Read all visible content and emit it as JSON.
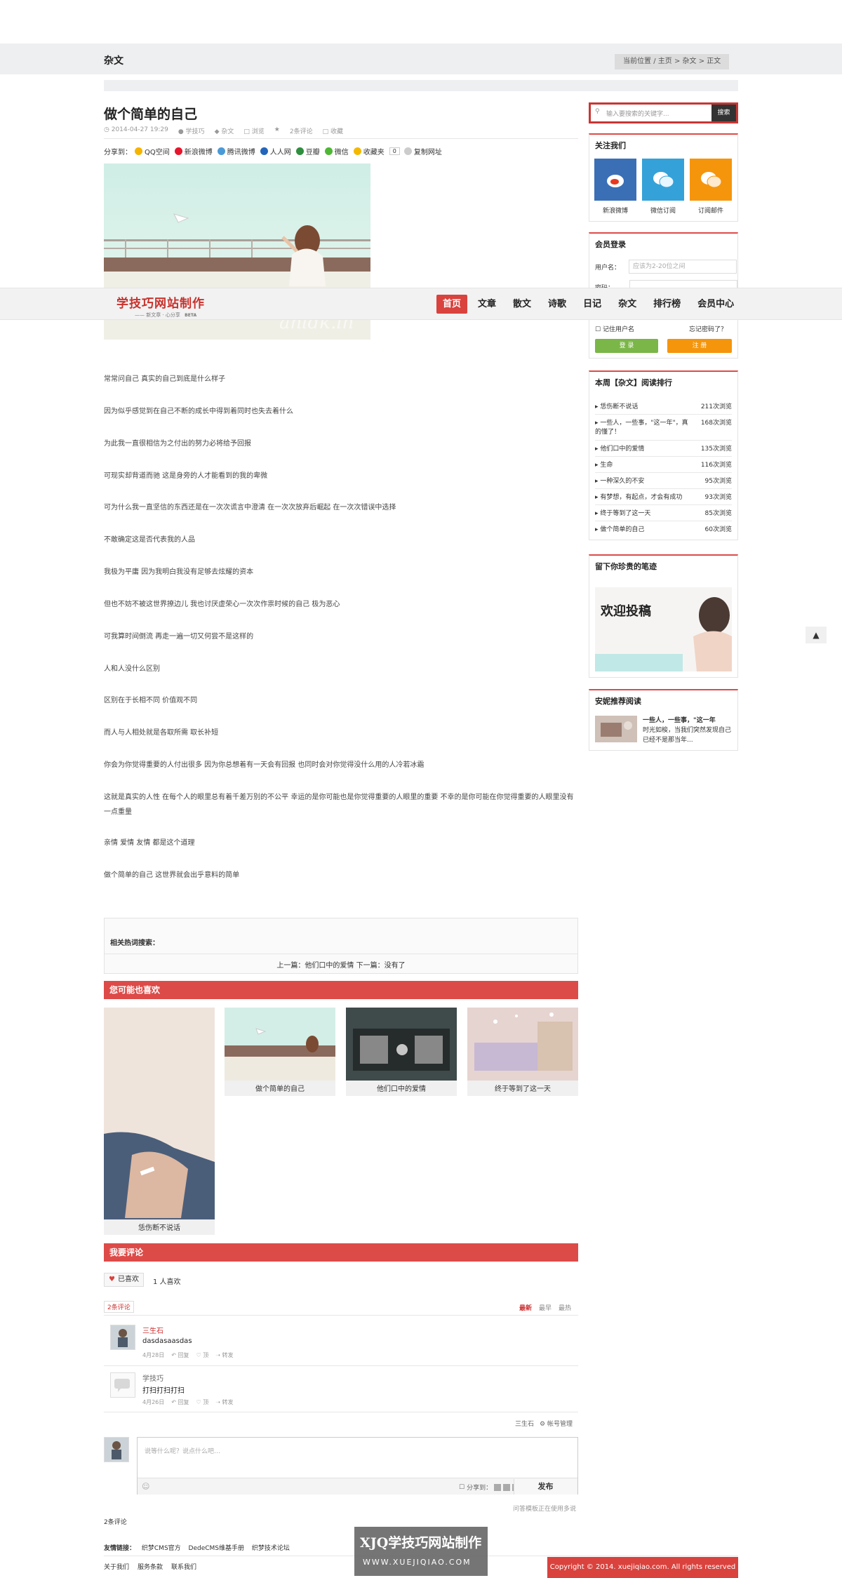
{
  "header": {
    "category": "杂文",
    "breadcrumb": {
      "prefix": "当前位置",
      "sep": "/",
      "home": "主页",
      "arrow": ">",
      "cat": "杂文",
      "current": "正文"
    }
  },
  "nav": {
    "logo_text": "学技巧网站制作",
    "logo_sub": "—— 新文章 · 心分享",
    "logo_badge": "BETA",
    "items": [
      "首页",
      "文章",
      "散文",
      "诗歌",
      "日记",
      "杂文",
      "排行榜",
      "会员中心"
    ],
    "active_index": 0
  },
  "article": {
    "title": "做个简单的自己",
    "meta": {
      "date": "2014-04-27 19:29",
      "author": "学技巧",
      "cat": "杂文",
      "views": "浏览",
      "comments": "2条评论",
      "fav": "收藏"
    },
    "share": {
      "label": "分享到：",
      "items": [
        {
          "label": "QQ空间",
          "color": "#f4b400"
        },
        {
          "label": "新浪微博",
          "color": "#e6162d"
        },
        {
          "label": "腾讯微博",
          "color": "#4a9ad8"
        },
        {
          "label": "人人网",
          "color": "#2266bb"
        },
        {
          "label": "豆瓣",
          "color": "#2f8f3f"
        },
        {
          "label": "微信",
          "color": "#4fb735"
        },
        {
          "label": "收藏夹",
          "color": "#f5b800"
        }
      ],
      "count": "0",
      "copy": "复制网址"
    },
    "image_watermark": "anldk.in",
    "paragraphs": [
      "常常问自己 真实的自己到底是什么样子",
      "因为似乎感觉到在自己不断的成长中得到着同时也失去着什么",
      "为此我一直很相信为之付出的努力必将给予回报",
      "可现实却背道而驰 这是身旁的人才能看到的我的卑微",
      "可为什么我一直坚信的东西还是在一次次谎言中澄清 在一次次放弃后崛起 在一次次错误中选择",
      "不敢确定这是否代表我的人品",
      "我极为平庸 因为我明白我没有足够去炫耀的资本",
      "但也不妨不被这世界撩边儿 我也讨厌虚荣心一次次作祟时候的自己 极为恶心",
      "可我算时间倒流 再走一遍一切又何尝不是这样的",
      "人和人没什么区别",
      "区别在于长相不同 价值观不同",
      "而人与人相处就是各取所需 取长补短",
      "你会为你觉得重要的人付出很多 因为你总想着有一天会有回报 也同时会对你觉得没什么用的人冷若冰霜",
      "这就是真实的人性 在每个人的眼里总有着千差万别的不公平 幸运的是你可能也是你觉得重要的人眼里的重要 不幸的是你可能在你觉得重要的人眼里没有一点重量",
      "亲情 爱情 友情 都是这个道理",
      "做个简单的自己 这世界就会出乎意料的简单"
    ],
    "hot_search": "相关热词搜索：",
    "prevnext": "上一篇：他们口中的爱情 下一篇：没有了"
  },
  "recommend": {
    "title": "您可能也喜欢",
    "items": [
      "恁伤断不说话",
      "做个简单的自己",
      "他们口中的爱情",
      "终于等到了这一天"
    ]
  },
  "comments": {
    "section_title": "我要评论",
    "like_label": "已喜欢",
    "like_count": "1 人喜欢",
    "count_badge": "2条评论",
    "sort": [
      "最新",
      "最早",
      "最热"
    ],
    "list": [
      {
        "name": "三生石",
        "text": "dasdasaasdas",
        "date": "4月28日",
        "reply": "回复",
        "up": "顶",
        "fwd": "转发"
      },
      {
        "name": "学技巧",
        "text": "打扫打扫打扫",
        "date": "4月26日",
        "reply": "回复",
        "up": "顶",
        "fwd": "转发"
      }
    ],
    "footer_user": "三生石",
    "footer_manage": "帐号管理",
    "placeholder": "说等什么呢？说点什么吧…",
    "share_to": "分享到：",
    "publish": "发布",
    "note": "问答模板正在使用多说",
    "total": "2条评论"
  },
  "footer": {
    "links_label": "友情链接：",
    "links": [
      "织梦CMS官方",
      "DedeCMS维基手册",
      "织梦技术论坛"
    ],
    "bottom": [
      "关于我们",
      "服务条款",
      "联系我们"
    ],
    "logo_main": "XJQ学技巧网站制作",
    "logo_url": "WWW.XUEJIQIAO.COM",
    "copyright": "Copyright © 2014. xuejiqiao.com. All rights reserved"
  },
  "sidebar": {
    "search_placeholder": "输入要搜索的关键字...",
    "search_button": "搜索",
    "follow": {
      "title": "关注我们",
      "items": [
        {
          "label": "新浪微博",
          "color": "#3a6fb6"
        },
        {
          "label": "微信订阅",
          "color": "#34a2d8"
        },
        {
          "label": "订阅邮件",
          "color": "#f5950c"
        }
      ]
    },
    "login": {
      "title": "会员登录",
      "user_label": "用户名：",
      "user_placeholder": "应该为2-20位之间",
      "pass_label": "密码：",
      "remember": "记住用户名",
      "forgot": "忘记密码了？",
      "login_btn": "登 录",
      "register_btn": "注 册"
    },
    "ranking": {
      "title": "本周【杂文】阅读排行",
      "items": [
        {
          "title": "恁伤断不说话",
          "views": "211次浏览"
        },
        {
          "title": "一些人，一些事，\"这一年\"，真",
          "views": "168次浏览",
          "title2": "的懂了！"
        },
        {
          "title": "他们口中的爱情",
          "views": "135次浏览"
        },
        {
          "title": "生命",
          "views": "116次浏览"
        },
        {
          "title": "一种深久的不安",
          "views": "95次浏览"
        },
        {
          "title": "有梦想，有起点，才会有成功",
          "views": "93次浏览"
        },
        {
          "title": "终于等到了这一天",
          "views": "85次浏览"
        },
        {
          "title": "做个简单的自己",
          "views": "60次浏览"
        }
      ]
    },
    "guestbook": {
      "title": "留下你珍贵的笔迹",
      "image_text": "欢迎投稿"
    },
    "recommend": {
      "title": "安妮推荐阅读",
      "text_bold": "一些人，一些事，\"这一年",
      "text_rest": "时光如梭，当我们突然发现自己已经不是那当年..."
    }
  },
  "to_top": "▲",
  "colors": {
    "accent": "#dd4b48",
    "nav_active": "#d9423d"
  }
}
